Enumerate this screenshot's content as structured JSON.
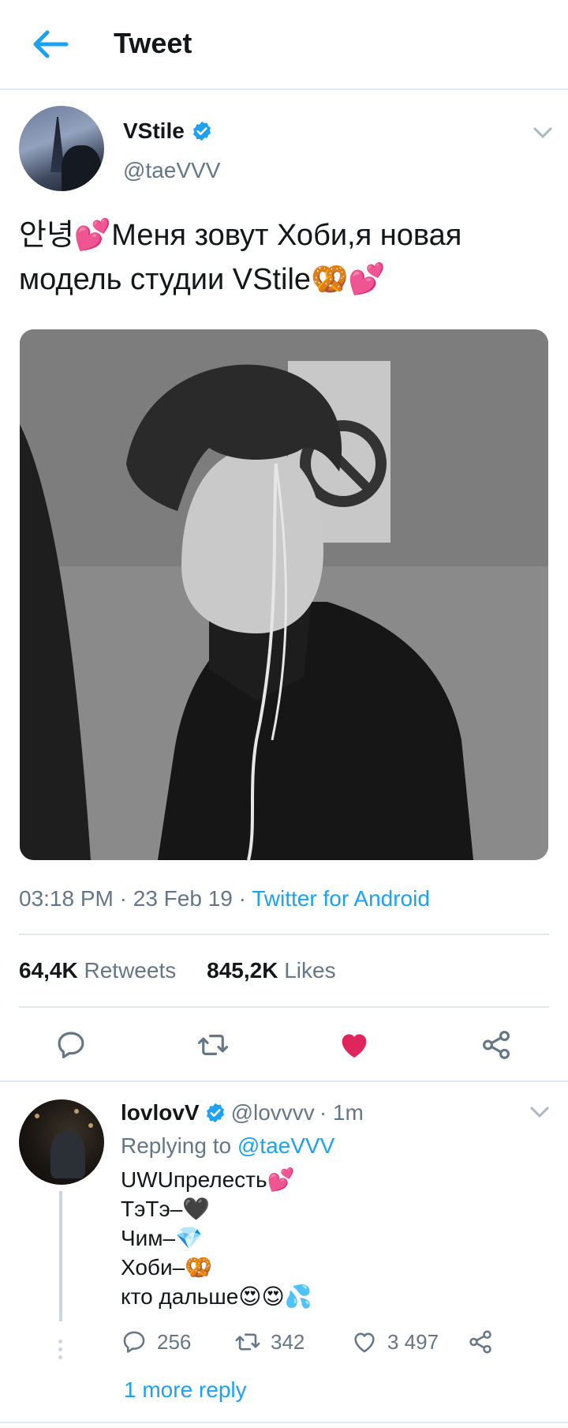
{
  "header": {
    "title": "Tweet"
  },
  "tweet": {
    "author_name": "VStile",
    "author_handle": "@taeVVV",
    "text_line1": "안녕💕Меня зовут Хоби,я новая",
    "text_line2": "модель студии VStile🥨💕",
    "time": "03:18 PM",
    "sep1": " · ",
    "date": "23 Feb 19",
    "sep2": " · ",
    "source": "Twitter for Android",
    "retweets_count": "64,4K",
    "retweets_label": "Retweets",
    "likes_count": "845,2K",
    "likes_label": "Likes",
    "liked": true
  },
  "reply": {
    "name": "lovlovV",
    "handle": "@lovvvv",
    "time": "· 1m",
    "replying_prefix": "Replying to",
    "replying_to": "@taeVVV",
    "lines": [
      "UWUпрелесть💕",
      "ТэТэ–🖤",
      "Чим–💎",
      "Хоби–🥨",
      "кто дальше😍😍💦"
    ],
    "reply_count": "256",
    "retweet_count": "342",
    "like_count": "3 497",
    "more_replies": "1 more reply"
  },
  "colors": {
    "accent": "#1da1f2",
    "like_red": "#e0245e",
    "muted": "#657786",
    "divider": "#e1e8ed"
  },
  "icons": [
    "back-arrow-icon",
    "verified-icon",
    "chevron-down-icon",
    "reply-icon",
    "retweet-icon",
    "heart-icon",
    "share-icon"
  ]
}
